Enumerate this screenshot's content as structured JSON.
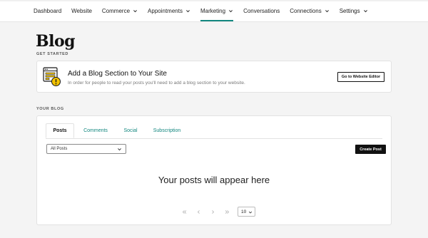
{
  "nav": {
    "items": [
      {
        "label": "Dashboard",
        "has_menu": false,
        "active": false
      },
      {
        "label": "Website",
        "has_menu": false,
        "active": false
      },
      {
        "label": "Commerce",
        "has_menu": true,
        "active": false
      },
      {
        "label": "Appointments",
        "has_menu": true,
        "active": false
      },
      {
        "label": "Marketing",
        "has_menu": true,
        "active": true
      },
      {
        "label": "Conversations",
        "has_menu": false,
        "active": false
      },
      {
        "label": "Connections",
        "has_menu": true,
        "active": false
      },
      {
        "label": "Settings",
        "has_menu": true,
        "active": false
      }
    ]
  },
  "page": {
    "title": "Blog"
  },
  "get_started": {
    "section_label": "GET STARTED",
    "banner_title": "Add a Blog Section to Your Site",
    "banner_desc": "In order for people to read your posts you'll need to add a blog section to your website.",
    "button_label": "Go to Website Editor"
  },
  "your_blog": {
    "section_label": "YOUR BLOG",
    "tabs": [
      {
        "label": "Posts",
        "active": true
      },
      {
        "label": "Comments",
        "active": false
      },
      {
        "label": "Social",
        "active": false
      },
      {
        "label": "Subscription",
        "active": false
      }
    ],
    "filter_value": "All Posts",
    "create_button": "Create Post",
    "empty_message": "Your posts will appear here",
    "pagination": {
      "first_icon": "double-chevron-left-icon",
      "prev_icon": "chevron-left-icon",
      "next_icon": "chevron-right-icon",
      "last_icon": "double-chevron-right-icon",
      "per_page": "10"
    }
  },
  "colors": {
    "accent": "#12877f",
    "dark_button": "#111111",
    "warning": "#f2c200",
    "background": "#f4f4f4"
  }
}
